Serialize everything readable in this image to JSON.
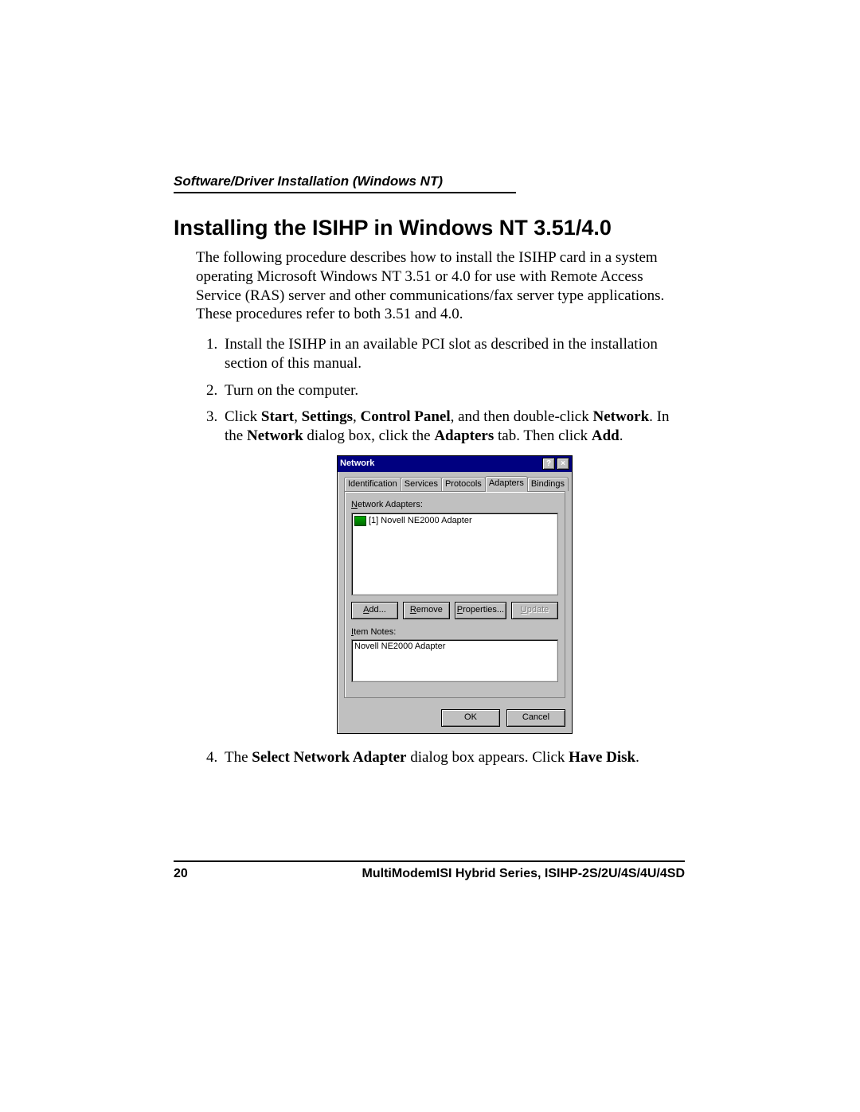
{
  "header": {
    "running_head": "Software/Driver Installation (Windows NT)"
  },
  "title": "Installing the ISIHP in Windows NT 3.51/4.0",
  "intro": "The following procedure describes how to install the ISIHP card  in a system operating Microsoft Windows NT 3.51 or 4.0 for use with Remote Access Service (RAS) server and other communications/fax server type applications. These procedures refer to both 3.51 and 4.0.",
  "steps": {
    "s1": "Install the ISIHP in an available PCI slot as described in the installation section of this manual.",
    "s2": "Turn on the computer.",
    "s3_pre": "Click ",
    "s3_b1": "Start",
    "s3_c1": ", ",
    "s3_b2": "Settings",
    "s3_c2": ", ",
    "s3_b3": "Control Panel",
    "s3_mid1": ", and then double-click ",
    "s3_b4": "Network",
    "s3_mid2": ". In the ",
    "s3_b5": "Network",
    "s3_mid3": " dialog box, click the ",
    "s3_b6": "Adapters",
    "s3_mid4": " tab. Then click ",
    "s3_b7": "Add",
    "s3_end": ".",
    "s4_pre": "The ",
    "s4_b1": "Select Network Adapter",
    "s4_mid": " dialog box appears. Click ",
    "s4_b2": "Have Disk",
    "s4_end": "."
  },
  "dialog": {
    "title": "Network",
    "help_glyph": "?",
    "close_glyph": "×",
    "tabs": {
      "identification": "Identification",
      "services": "Services",
      "protocols": "Protocols",
      "adapters": "Adapters",
      "bindings": "Bindings"
    },
    "adapters_label_u": "N",
    "adapters_label_rest": "etwork Adapters:",
    "adapter_item": "[1] Novell NE2000 Adapter",
    "buttons": {
      "add_u": "A",
      "add_rest": "dd...",
      "remove_u": "R",
      "remove_rest": "emove",
      "properties_u": "P",
      "properties_rest": "roperties...",
      "update_u": "U",
      "update_rest": "pdate"
    },
    "item_notes_label_u": "I",
    "item_notes_label_rest": "tem Notes:",
    "item_notes_value": "Novell NE2000 Adapter",
    "ok": "OK",
    "cancel": "Cancel"
  },
  "footer": {
    "page_number": "20",
    "product": "MultiModemISI Hybrid Series, ISIHP-2S/2U/4S/4U/4SD"
  }
}
